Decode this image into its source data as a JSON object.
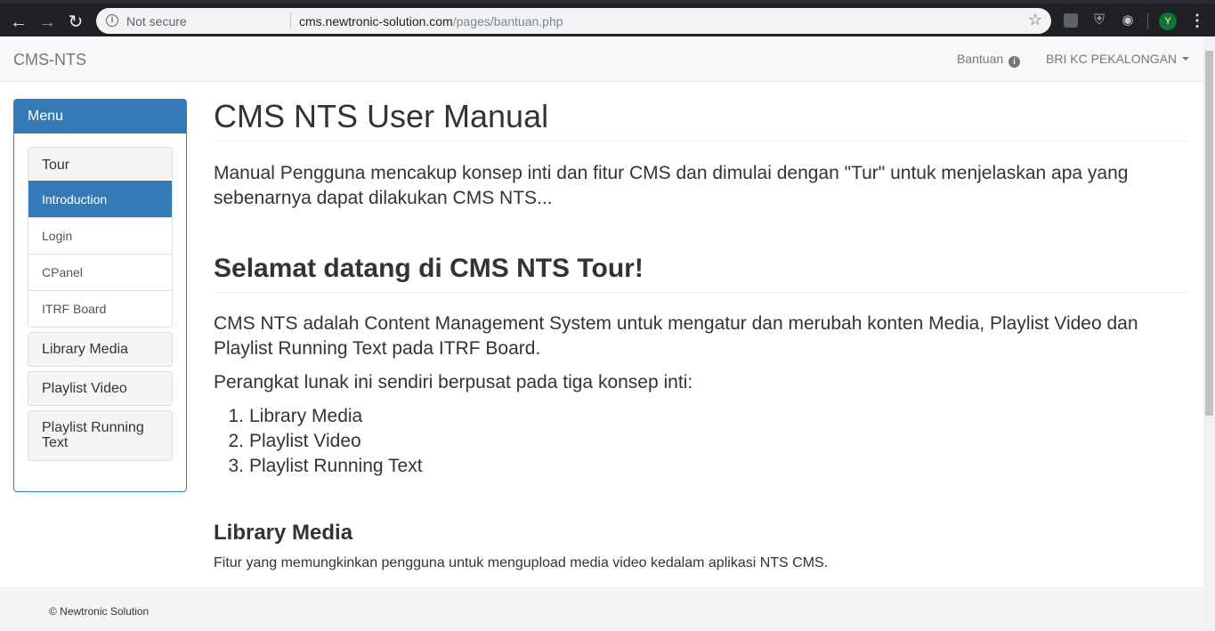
{
  "browser": {
    "back_icon": "arrow-left-icon",
    "forward_icon": "arrow-right-icon",
    "reload_icon": "reload-icon",
    "security_label": "Not secure",
    "url_host": "cms.newtronic-solution.com",
    "url_path": "/pages/bantuan.php",
    "profile_initial": "Y"
  },
  "navbar": {
    "brand": "CMS-NTS",
    "help_label": "Bantuan",
    "user_label": "BRI KC PEKALONGAN"
  },
  "sidebar": {
    "title": "Menu",
    "groups": [
      {
        "label": "Tour",
        "items": [
          "Introduction",
          "Login",
          "CPanel",
          "ITRF Board"
        ],
        "active_item": "Introduction"
      },
      {
        "label": "Library Media"
      },
      {
        "label": "Playlist Video"
      },
      {
        "label": "Playlist Running Text"
      }
    ]
  },
  "main": {
    "title": "CMS NTS User Manual",
    "lead": "Manual Pengguna mencakup konsep inti dan fitur CMS dan dimulai dengan \"Tur\" untuk menjelaskan apa yang sebenarnya dapat dilakukan CMS NTS...",
    "section_title": "Selamat datang di CMS NTS Tour!",
    "intro": "CMS NTS adalah Content Management System untuk mengatur dan merubah konten Media, Playlist Video dan Playlist Running Text pada ITRF Board.",
    "concepts_intro": "Perangkat lunak ini sendiri berpusat pada tiga konsep inti:",
    "concepts": [
      "Library Media",
      "Playlist Video",
      "Playlist Running Text"
    ],
    "sub_title": "Library Media",
    "sub_text": "Fitur yang memungkinkan pengguna untuk mengupload media video kedalam aplikasi NTS CMS."
  },
  "footer": {
    "text": "© Newtronic Solution"
  },
  "colors": {
    "primary": "#337ab7",
    "browser_chrome": "#202124",
    "navbar_bg": "#f8f8f8"
  }
}
